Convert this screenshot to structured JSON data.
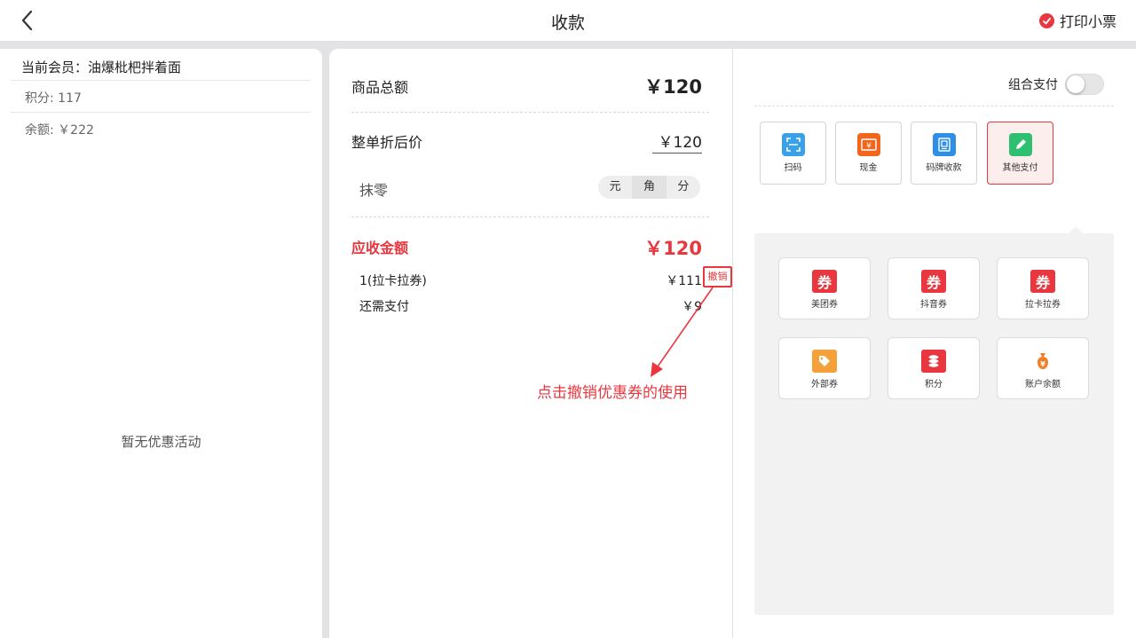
{
  "header": {
    "title": "收款",
    "print_label": "打印小票"
  },
  "left": {
    "member_label": "当前会员：",
    "member_name": "油爆枇杷拌着面",
    "points": "积分: 117",
    "balance": "余额: ￥222",
    "no_promo": "暂无优惠活动"
  },
  "mid": {
    "goods_total_label": "商品总额",
    "goods_total_value": "￥120",
    "discount_price_label": "整单折后价",
    "discount_price_value": "￥120",
    "round_label": "抹零",
    "round_options": [
      "元",
      "角",
      "分"
    ],
    "receivable_label": "应收金额",
    "receivable_value": "￥120",
    "coupon_line_label": "1(拉卡拉券)",
    "coupon_line_value": "￥111",
    "cancel_label": "撤销",
    "remaining_label": "还需支付",
    "remaining_value": "￥9",
    "annotation": "点击撤销优惠券的使用"
  },
  "right": {
    "combo_label": "组合支付",
    "methods": [
      {
        "label": "扫码",
        "icon": "scan-icon",
        "color": "#3aa0e8"
      },
      {
        "label": "现金",
        "icon": "cash-icon",
        "color": "#f2651d"
      },
      {
        "label": "码牌收款",
        "icon": "qr-plate-icon",
        "color": "#2f8fe6"
      },
      {
        "label": "其他支付",
        "icon": "edit-icon",
        "color": "#2fbf71"
      }
    ],
    "sub_methods": [
      {
        "label": "美团券",
        "glyph": "券",
        "color": "#e8373e"
      },
      {
        "label": "抖音券",
        "glyph": "券",
        "color": "#e8373e"
      },
      {
        "label": "拉卡拉券",
        "glyph": "券",
        "color": "#e8373e"
      },
      {
        "label": "外部券",
        "glyph": "",
        "color": "#f5a13a"
      },
      {
        "label": "积分",
        "glyph": "",
        "color": "#e8373e"
      },
      {
        "label": "账户余额",
        "glyph": "",
        "color": "#f07f2b"
      }
    ]
  }
}
